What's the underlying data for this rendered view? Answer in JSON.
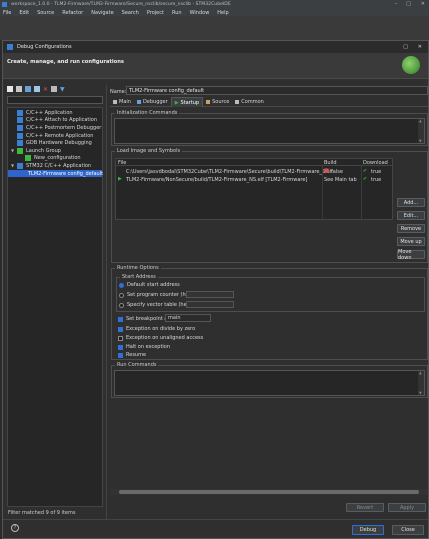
{
  "ide": {
    "title": "workspace_1.0.0 - TLM2-Firmware/TLM2-Firmware/Secure_nsclib/secure_nsclib - STM32CubeIDE",
    "menu": [
      "File",
      "Edit",
      "Source",
      "Refactor",
      "Navigate",
      "Search",
      "Project",
      "Run",
      "Window",
      "Help"
    ]
  },
  "dialog": {
    "title": "Debug Configurations",
    "heading": "Create, manage, and run configurations",
    "filter_status": "Filter matched 9 of 9 items",
    "tree": [
      {
        "label": "C/C++ Application",
        "indent": 0,
        "icon": "c-app-icon"
      },
      {
        "label": "C/C++ Attach to Application",
        "indent": 0,
        "icon": "c-attach-icon"
      },
      {
        "label": "C/C++ Postmortem Debugger",
        "indent": 0,
        "icon": "c-postmortem-icon"
      },
      {
        "label": "C/C++ Remote Application",
        "indent": 0,
        "icon": "c-remote-icon"
      },
      {
        "label": "GDB Hardware Debugging",
        "indent": 0,
        "icon": "gdb-icon"
      },
      {
        "label": "Launch Group",
        "indent": 0,
        "icon": "launch-group-icon"
      },
      {
        "label": "New_configuration",
        "indent": 1,
        "icon": "launch-config-icon"
      },
      {
        "label": "STM32 C/C++ Application",
        "indent": 0,
        "icon": "stm32-app-icon"
      },
      {
        "label": "TLM2-Firmware config_default",
        "indent": 1,
        "icon": "stm32-config-icon",
        "selected": true
      }
    ],
    "name_label": "Name:",
    "name_value": "TLM2-Firmware config_default",
    "tabs": [
      {
        "label": "Main",
        "icon": "main-tab-icon"
      },
      {
        "label": "Debugger",
        "icon": "debugger-tab-icon"
      },
      {
        "label": "Startup",
        "icon": "startup-tab-icon",
        "active": true
      },
      {
        "label": "Source",
        "icon": "source-tab-icon"
      },
      {
        "label": "Common",
        "icon": "common-tab-icon"
      }
    ],
    "init_commands_label": "Initialization Commands",
    "load_images_label": "Load Image and Symbols",
    "table": {
      "headers": [
        "File",
        "Build",
        "Download"
      ],
      "rows": [
        {
          "file": "C:\\Users\\jasvdbodal\\STM32Cube\\TLM2-Firmware\\Secure\\build\\TLM2-Firmware_S.elf",
          "build": "false",
          "download": "true"
        },
        {
          "file": "TLM2-Firmware/NonSecure/build/TLM2-Firmware_NS.elf [TLM2-Firmware]",
          "build": "See Main tab",
          "download": "true"
        }
      ]
    },
    "table_buttons": [
      "Add...",
      "Edit...",
      "Remove",
      "Move up",
      "Move down"
    ],
    "runtime_label": "Runtime Options",
    "start_address_label": "Start Address",
    "radios": [
      {
        "label": "Default start address",
        "checked": true
      },
      {
        "label": "Set program counter (hex):",
        "checked": false
      },
      {
        "label": "Specify vector table (hex):",
        "checked": false
      }
    ],
    "breakpoint_label": "Set breakpoint at:",
    "breakpoint_value": "main",
    "checks": [
      {
        "label": "Exception on divide by zero",
        "checked": true
      },
      {
        "label": "Exception on unaligned access",
        "checked": false
      },
      {
        "label": "Halt on exception",
        "checked": true
      },
      {
        "label": "Resume",
        "checked": true
      }
    ],
    "run_commands_label": "Run Commands",
    "revert_label": "Revert",
    "apply_label": "Apply",
    "debug_label": "Debug",
    "close_label": "Close"
  },
  "colors": {
    "accent": "#2f6fd6",
    "selected": "#2f65ca",
    "green": "#3db83d",
    "red_x": "#d9534f"
  }
}
